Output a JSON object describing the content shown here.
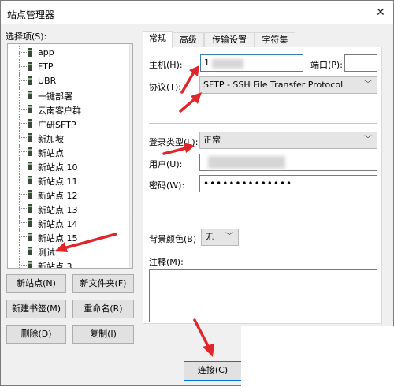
{
  "window": {
    "title": "站点管理器",
    "close_glyph": "✕"
  },
  "tree": {
    "label": "选择项(S):",
    "items": [
      "app",
      "FTP",
      "UBR",
      "一键部署",
      "云南客户群",
      "广研SFTP",
      "新加坡",
      "新站点",
      "新站点 10",
      "新站点 11",
      "新站点 12",
      "新站点 13",
      "新站点 14",
      "新站点 15",
      "测试",
      "新站点 3"
    ]
  },
  "left_buttons": {
    "new_site": "新站点(N)",
    "new_folder": "新文件夹(F)",
    "new_bookmark": "新建书签(M)",
    "rename": "重命名(R)",
    "delete": "删除(D)",
    "copy": "复制(I)"
  },
  "tabs": [
    "常规",
    "高级",
    "传输设置",
    "字符集"
  ],
  "form": {
    "host_label": "主机(H):",
    "host_value": "1",
    "port_label": "端口(P):",
    "port_value": "",
    "protocol_label": "协议(T):",
    "protocol_value": "SFTP - SSH File Transfer Protocol",
    "logon_type_label": "登录类型(L):",
    "logon_type_value": "正常",
    "user_label": "用户(U):",
    "user_value": "",
    "password_label": "密码(W):",
    "password_value": "••••••••••••••",
    "bg_color_label": "背景颜色(B)",
    "bg_color_value": "无",
    "comment_label": "注释(M):"
  },
  "connect_button": "连接(C)",
  "accent_color": "#e0262b"
}
